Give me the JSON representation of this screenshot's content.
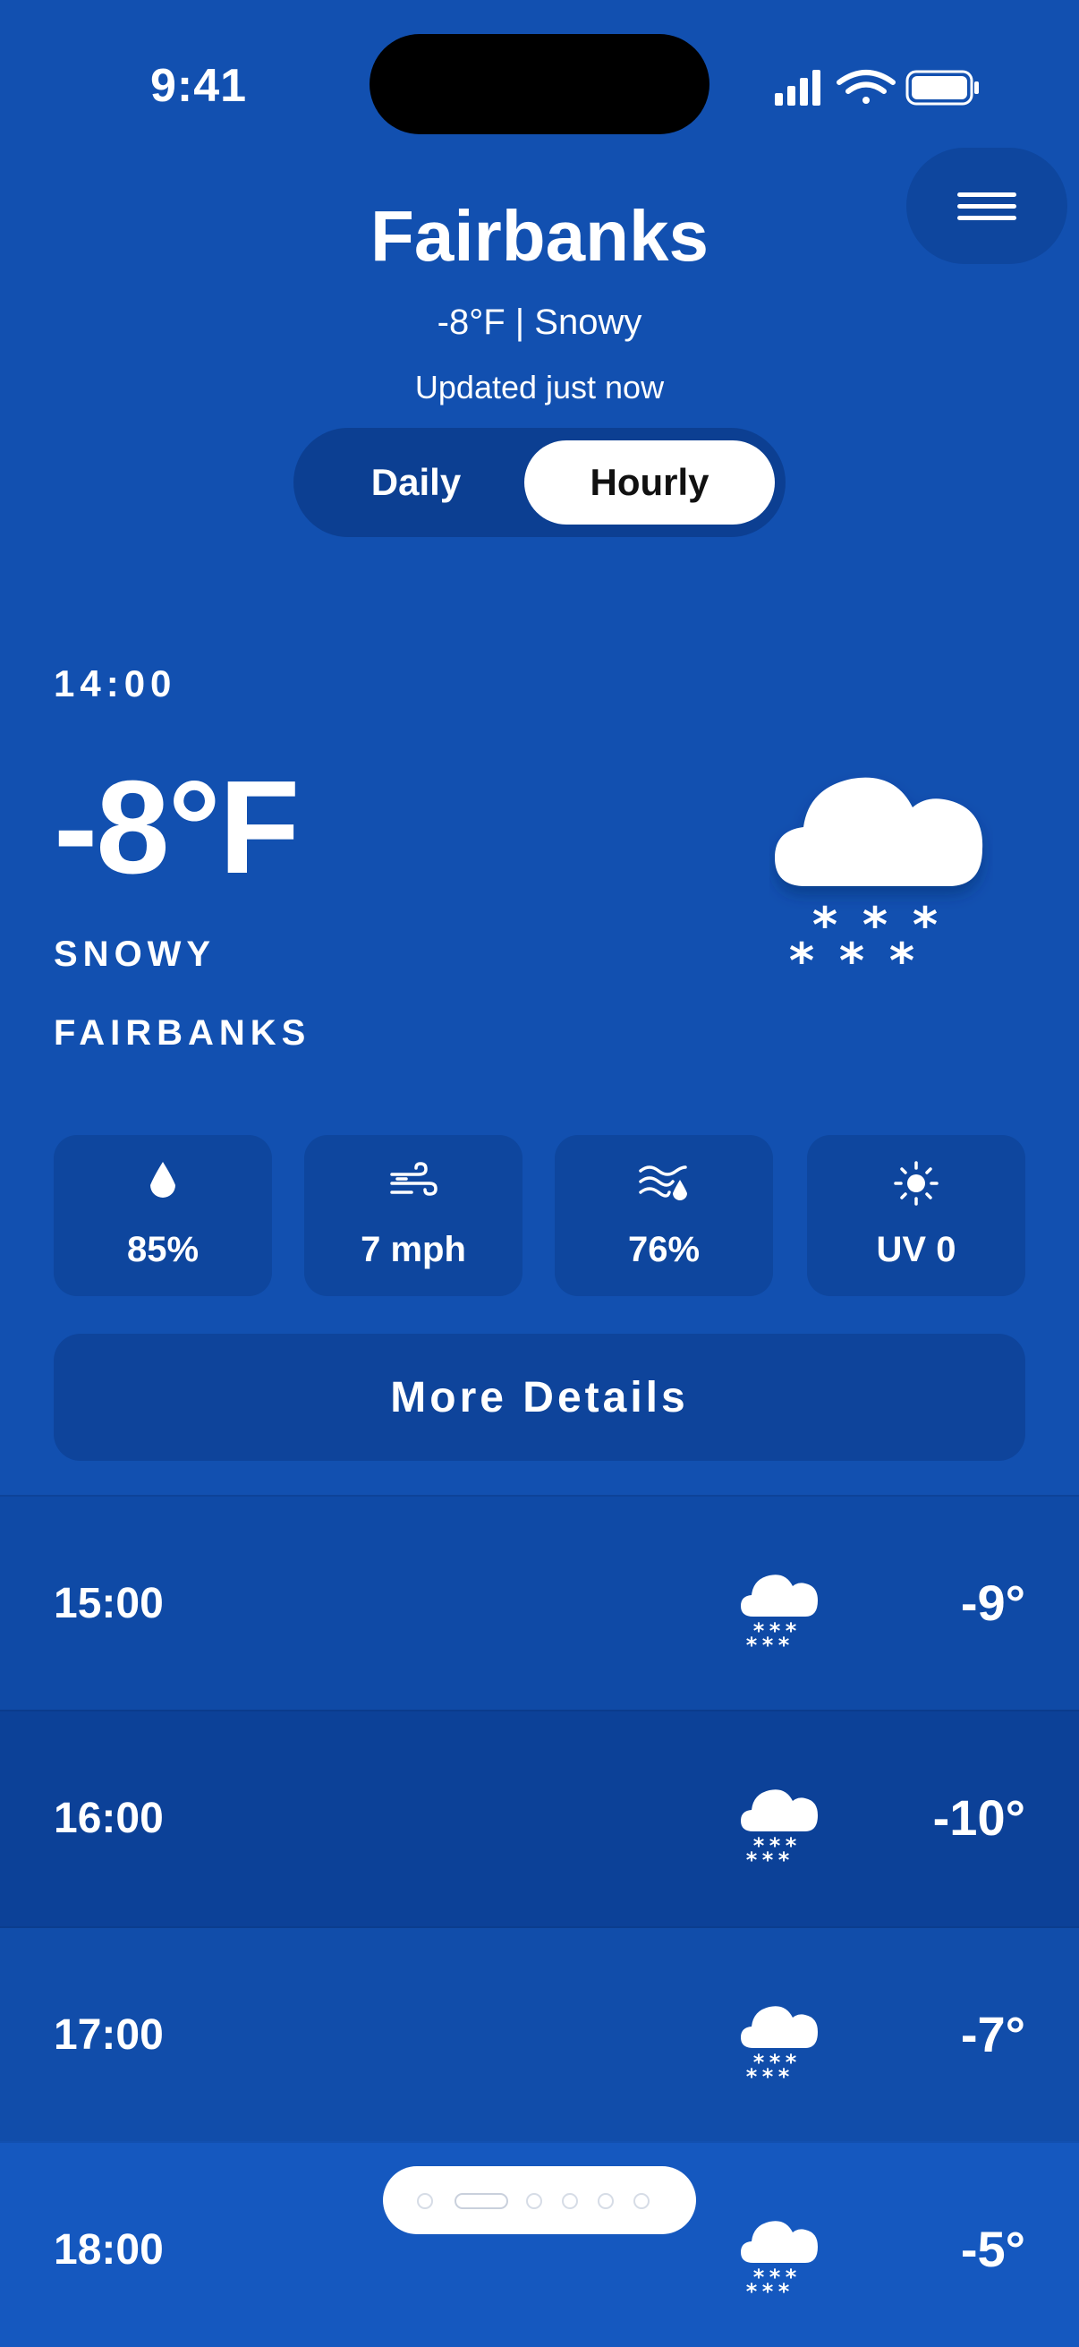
{
  "status_bar": {
    "time": "9:41"
  },
  "header": {
    "city": "Fairbanks",
    "summary": "-8°F | Snowy",
    "updated": "Updated just now"
  },
  "toggle": {
    "daily_label": "Daily",
    "hourly_label": "Hourly",
    "selected": "Hourly"
  },
  "current": {
    "time": "14:00",
    "temp": "-8°F",
    "condition": "SNOWY",
    "city": "FAIRBANKS",
    "icon": "snow-cloud-icon"
  },
  "stats": [
    {
      "icon": "droplet-icon",
      "value": "85%"
    },
    {
      "icon": "wind-icon",
      "value": "7 mph"
    },
    {
      "icon": "humidity-wave-icon",
      "value": "76%"
    },
    {
      "icon": "sun-icon",
      "value": "UV 0"
    }
  ],
  "more_details_label": "More Details",
  "hourly": [
    {
      "time": "15:00",
      "temp": "-9°",
      "icon": "snow-cloud-icon"
    },
    {
      "time": "16:00",
      "temp": "-10°",
      "icon": "snow-cloud-icon"
    },
    {
      "time": "17:00",
      "temp": "-7°",
      "icon": "snow-cloud-icon"
    },
    {
      "time": "18:00",
      "temp": "-5°",
      "icon": "snow-cloud-icon"
    }
  ],
  "pager": {
    "pages": 7,
    "active_index": 1
  },
  "colors": {
    "background": "#1250b0",
    "tile": "#0e469e",
    "row_1": "#0f4aa6",
    "row_2": "#0c4198",
    "row_3": "#114daa",
    "row_4": "#1558bf"
  }
}
